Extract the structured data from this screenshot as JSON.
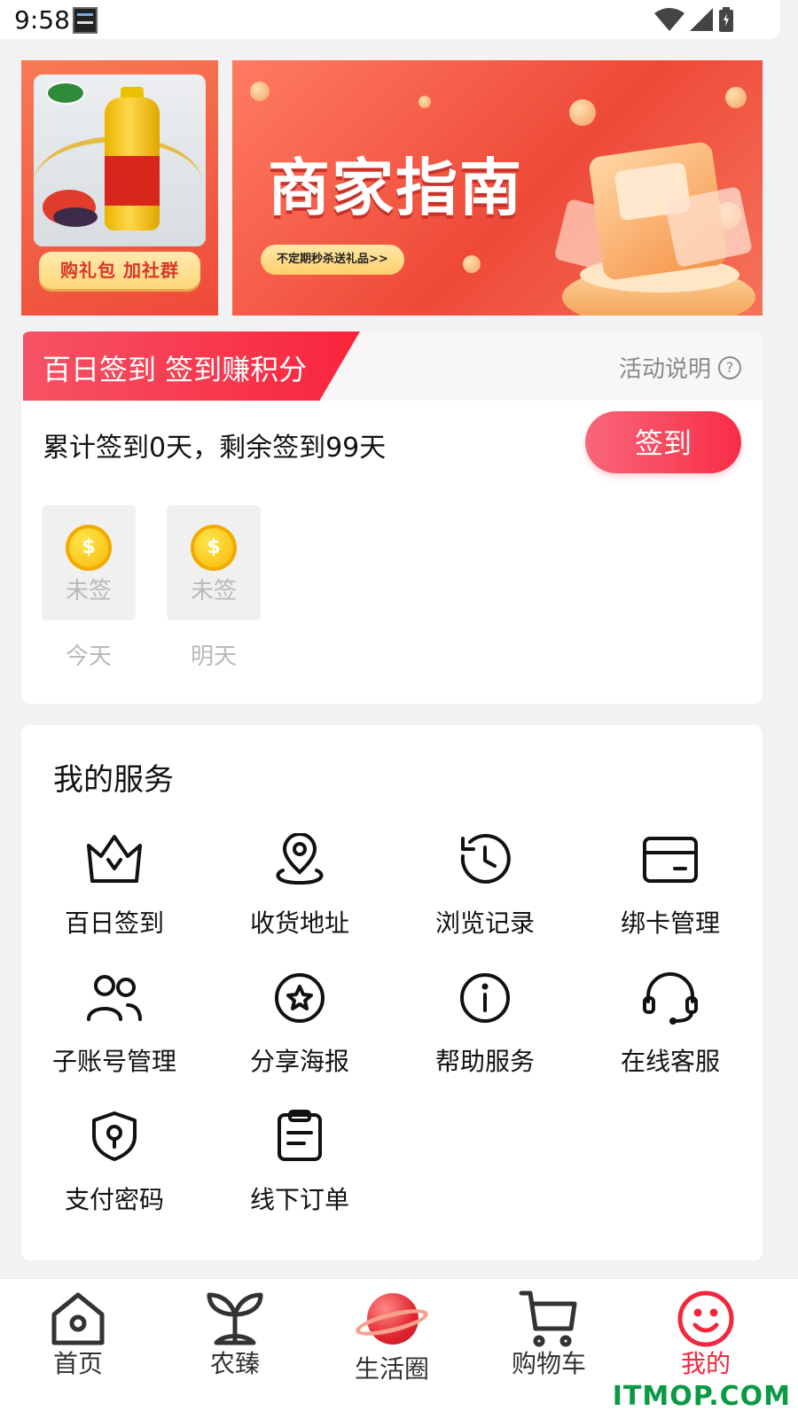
{
  "status_bar": {
    "time": "9:58"
  },
  "banners": {
    "small": {
      "button_label": "购礼包 加社群"
    },
    "big": {
      "title": "商家指南",
      "subtitle": "不定期秒杀送礼品>>"
    }
  },
  "checkin": {
    "title": "百日签到 签到赚积分",
    "activity_desc": "活动说明",
    "summary": "累计签到0天，剩余签到99天",
    "button_label": "签到",
    "days": [
      {
        "status": "未签",
        "label": "今天"
      },
      {
        "status": "未签",
        "label": "明天"
      }
    ]
  },
  "services": {
    "title": "我的服务",
    "items": [
      {
        "label": "百日签到",
        "icon": "crown-icon"
      },
      {
        "label": "收货地址",
        "icon": "location-pin-icon"
      },
      {
        "label": "浏览记录",
        "icon": "history-clock-icon"
      },
      {
        "label": "绑卡管理",
        "icon": "card-icon"
      },
      {
        "label": "子账号管理",
        "icon": "users-icon"
      },
      {
        "label": "分享海报",
        "icon": "star-circle-icon"
      },
      {
        "label": "帮助服务",
        "icon": "info-icon"
      },
      {
        "label": "在线客服",
        "icon": "headset-icon"
      },
      {
        "label": "支付密码",
        "icon": "shield-lock-icon"
      },
      {
        "label": "线下订单",
        "icon": "clipboard-icon"
      }
    ]
  },
  "tabbar": {
    "items": [
      {
        "label": "首页",
        "icon": "home-icon"
      },
      {
        "label": "农臻",
        "icon": "sprout-icon"
      },
      {
        "label": "生活圈",
        "icon": "planet-icon"
      },
      {
        "label": "购物车",
        "icon": "cart-icon"
      },
      {
        "label": "我的",
        "icon": "smile-icon",
        "active": true
      }
    ]
  },
  "watermark": "ITMOP.COM",
  "colors": {
    "accent": "#f82d46",
    "coin": "#f5b400"
  }
}
